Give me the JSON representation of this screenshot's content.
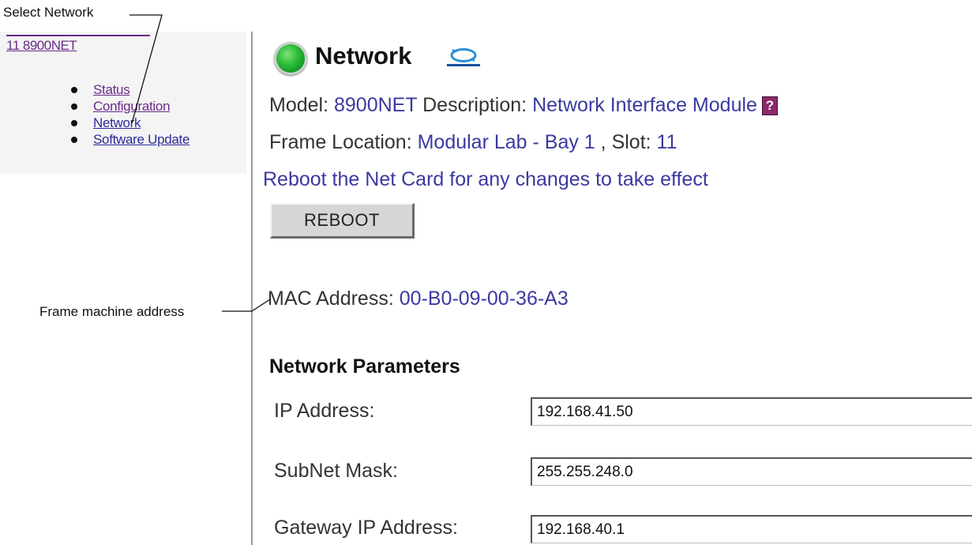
{
  "callouts": {
    "select_network": "Select Network",
    "frame_machine_address": "Frame machine address"
  },
  "sidebar": {
    "frame_link": "11 8900NET",
    "items": [
      {
        "label": "Status"
      },
      {
        "label": "Configuration"
      },
      {
        "label": "Network"
      },
      {
        "label": "Software Update"
      }
    ]
  },
  "header": {
    "title": "Network",
    "status_icon": "green-status-led-icon",
    "refresh_icon": "refresh-icon"
  },
  "module": {
    "model_label": "Model:",
    "model_value": "8900NET",
    "description_label": "Description:",
    "description_value": "Network Interface Module",
    "help_icon": "?",
    "frame_location_label": "Frame Location:",
    "frame_location_value": "Modular Lab - Bay 1",
    "slot_label": ", Slot:",
    "slot_value": "11",
    "reboot_note": "Reboot the Net Card for any changes to take effect",
    "reboot_button": "REBOOT",
    "mac_label": "MAC Address:",
    "mac_value": "00-B0-09-00-36-A3"
  },
  "network_parameters": {
    "title": "Network Parameters",
    "fields": [
      {
        "label": "IP Address:",
        "value": "192.168.41.50"
      },
      {
        "label": "SubNet Mask:",
        "value": "255.255.248.0"
      },
      {
        "label": "Gateway IP Address:",
        "value": "192.168.40.1"
      }
    ]
  },
  "colors": {
    "link_purple": "#6a2a8a",
    "value_blue": "#3a3aa0",
    "status_green": "#2fbf3a"
  }
}
